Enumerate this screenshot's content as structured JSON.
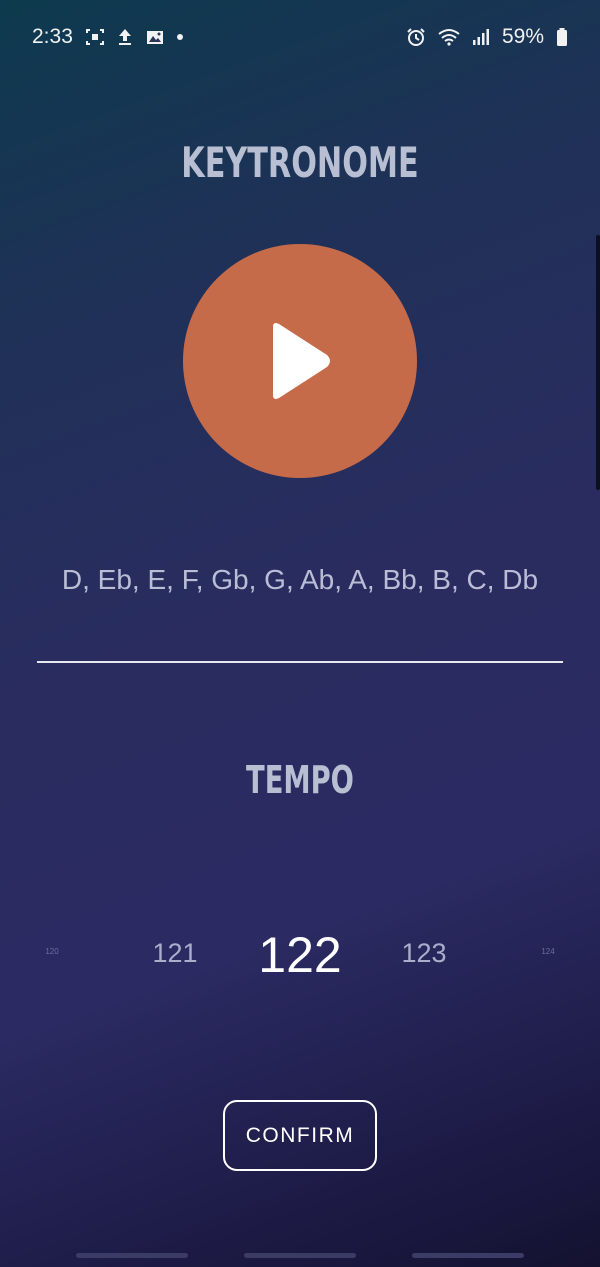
{
  "status_bar": {
    "time": "2:33",
    "battery_percent": "59%",
    "left_icons": [
      "screenshot-icon",
      "upload-icon",
      "gallery-icon",
      "notification-dot"
    ],
    "right_icons": [
      "alarm-icon",
      "wifi-icon",
      "signal-icon",
      "battery-icon"
    ]
  },
  "app": {
    "title": "KEYTRONOME",
    "play_icon": "play-icon",
    "keys_sequence": "D, Eb, E, F, Gb, G, Ab, A, Bb, B, C, Db",
    "tempo_label": "TEMPO",
    "tempo": {
      "values": [
        "120",
        "121",
        "122",
        "123",
        "124"
      ],
      "selected": "122"
    },
    "confirm_label": "CONFIRM"
  },
  "colors": {
    "accent": "#c66b4a",
    "title_text": "#b8bfd3",
    "background_top": "#0d3a4e",
    "background_mid": "#2a2c60",
    "background_bottom": "#14122f"
  }
}
